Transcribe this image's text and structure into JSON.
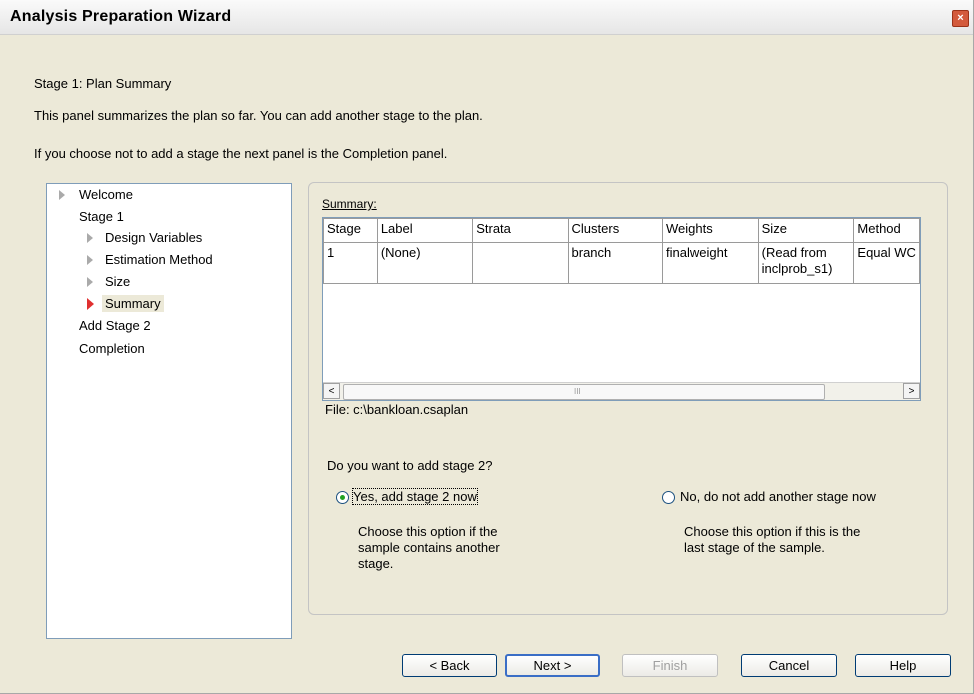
{
  "window": {
    "title": "Analysis Preparation Wizard",
    "close_glyph": "×"
  },
  "header": {
    "stage_title": "Stage 1: Plan Summary",
    "description": "This panel summarizes the plan so far.  You can add another stage to the plan.",
    "note": "If you choose not to add a stage the next panel is the Completion panel."
  },
  "nav": {
    "items": [
      {
        "label": "Welcome",
        "icon": "triangle-right-icon"
      },
      {
        "label": "Stage 1"
      },
      {
        "label": "Design Variables",
        "icon": "triangle-right-icon"
      },
      {
        "label": "Estimation Method",
        "icon": "triangle-right-icon"
      },
      {
        "label": "Size",
        "icon": "triangle-right-icon"
      },
      {
        "label": "Summary",
        "icon": "triangle-right-active-icon",
        "selected": true
      },
      {
        "label": "Add Stage 2"
      },
      {
        "label": "Completion"
      }
    ]
  },
  "summary": {
    "label": "Summary:",
    "columns": [
      "Stage",
      "Label",
      "Strata",
      "Clusters",
      "Weights",
      "Size",
      "Method"
    ],
    "rows": [
      [
        "1",
        "(None)",
        "",
        "branch",
        "finalweight",
        "(Read from\ninclprob_s1)",
        "Equal WC"
      ]
    ],
    "scroll_left": "<",
    "scroll_right": ">",
    "scroll_grip": "III",
    "file": "File: c:\\bankloan.csaplan"
  },
  "question": "Do you want to add stage 2?",
  "options": {
    "yes": {
      "label": "Yes, add stage 2 now",
      "desc": "Choose this option if the\nsample contains another\nstage.",
      "checked": true
    },
    "no": {
      "label": "No, do not add another stage now",
      "desc": "Choose this option if this is the\nlast stage of the sample.",
      "checked": false
    }
  },
  "buttons": {
    "back": "< Back",
    "next": "Next >",
    "finish": "Finish",
    "cancel": "Cancel",
    "help": "Help"
  },
  "colors": {
    "accent_red": "#e03030",
    "radio_green": "#21a121",
    "border_blue": "#7f9db9"
  }
}
